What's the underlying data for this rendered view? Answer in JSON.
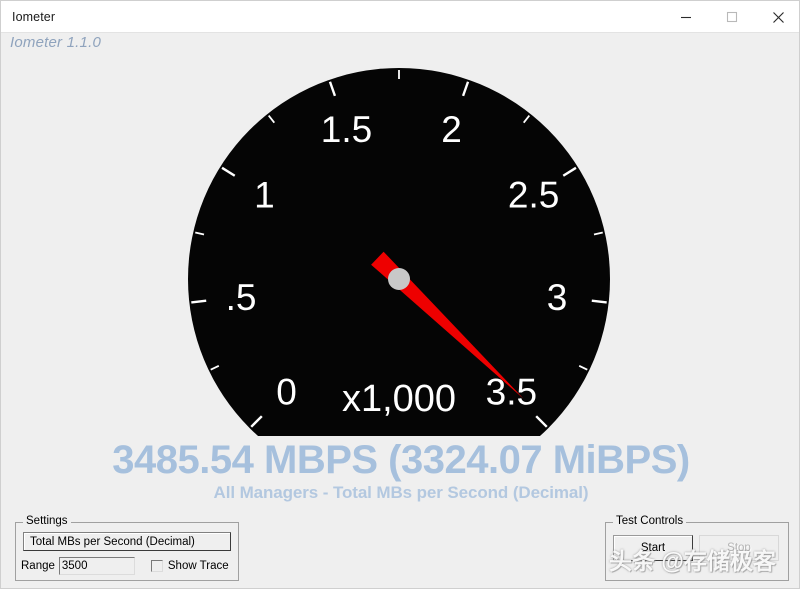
{
  "window": {
    "title": "Iometer",
    "controls": {
      "minimize": "minimize-icon",
      "maximize": "maximize-icon",
      "close": "close-icon"
    }
  },
  "version_label": "Iometer 1.1.0",
  "readout": {
    "main": "3485.54 MBPS (3324.07 MiBPS)",
    "subtitle": "All Managers - Total MBs per Second (Decimal)",
    "main_color": "#a6c0dd",
    "subtitle_color": "#b3c8e0"
  },
  "settings": {
    "group_title": "Settings",
    "metric_selected": "Total MBs per Second (Decimal)",
    "range_label": "Range",
    "range_value": "3500",
    "show_trace_label": "Show Trace",
    "show_trace_checked": false
  },
  "test_controls": {
    "group_title": "Test Controls",
    "start_label": "Start",
    "stop_label": "Stop",
    "stop_disabled": true
  },
  "watermark": "头条 @存储极客",
  "chart_data": {
    "type": "gauge",
    "title": "All Managers - Total MBs per Second (Decimal)",
    "multiplier_label": "x1,000",
    "tick_labels": [
      "0",
      ".5",
      "1",
      "1.5",
      "2",
      "2.5",
      "3",
      "3.5"
    ],
    "tick_values": [
      0,
      500,
      1000,
      1500,
      2000,
      2500,
      3000,
      3500
    ],
    "minor_ticks_per_major": 1,
    "range": [
      0,
      3500
    ],
    "value": 3485.54,
    "value_display": "3485.54 MBPS (3324.07 MiBPS)",
    "value_mibps": 3324.07,
    "needle_color": "#ee0000",
    "face_color": "#050505",
    "tick_color": "#ffffff",
    "label_color": "#ffffff",
    "hub_color": "#c8c8c8",
    "start_angle_deg": 225,
    "sweep_deg": 270,
    "grid": false,
    "legend": "none"
  }
}
